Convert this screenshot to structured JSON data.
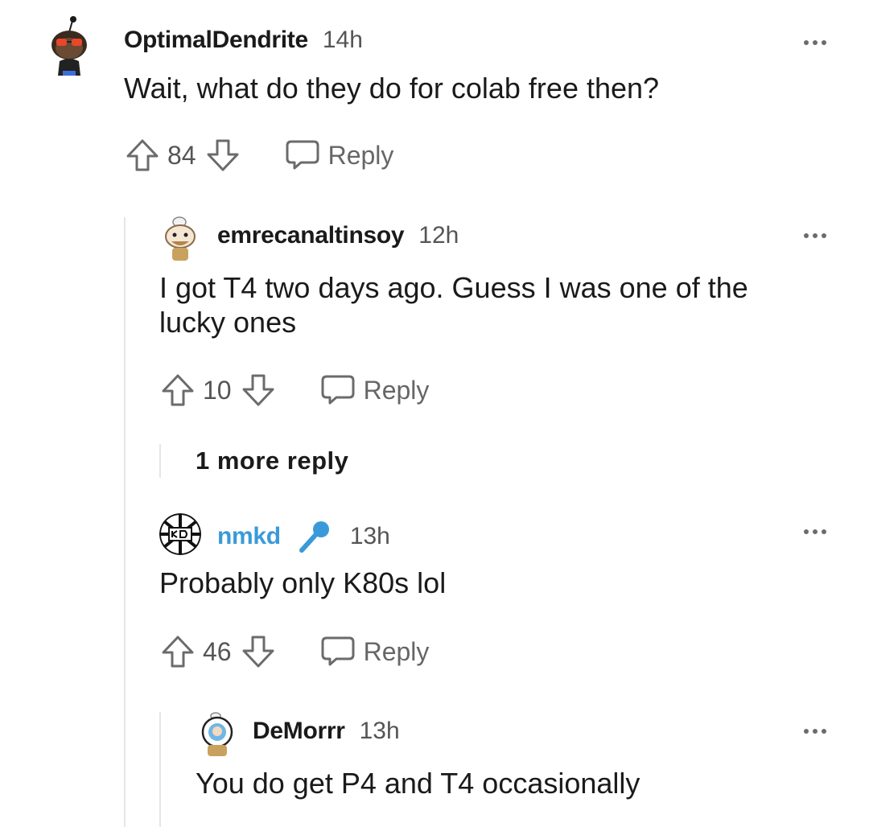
{
  "comments": [
    {
      "username": "OptimalDendrite",
      "time": "14h",
      "body": "Wait, what do they do for colab free then?",
      "votes": "84",
      "reply_label": "Reply"
    },
    {
      "username": "emrecanaltinsoy",
      "time": "12h",
      "body": "I got T4 two days ago. Guess I was one of the lucky ones",
      "votes": "10",
      "reply_label": "Reply"
    },
    {
      "username": "nmkd",
      "time": "13h",
      "body": "Probably only K80s lol",
      "votes": "46",
      "reply_label": "Reply",
      "flair_icon": "microphone-icon"
    },
    {
      "username": "DeMorrr",
      "time": "13h",
      "body": "You do get P4 and T4 occasionally"
    }
  ],
  "more_replies_label": "1 more reply",
  "colors": {
    "text": "#1a1a1b",
    "muted": "#666666",
    "link_user": "#3a9ad9",
    "thread_line": "#e6e6e6"
  }
}
